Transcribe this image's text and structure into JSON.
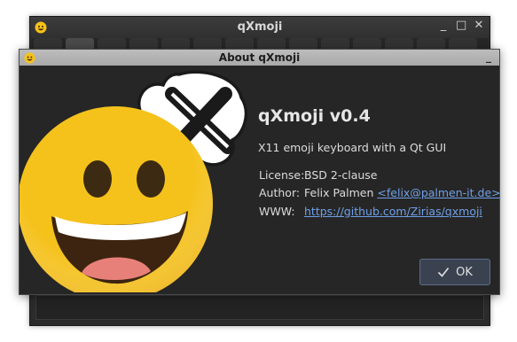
{
  "main_window": {
    "title": "qXmoji",
    "buttons": {
      "minimize": "_",
      "maximize": "□",
      "close": "✕"
    }
  },
  "dialog": {
    "title": "About qXmoji",
    "app_name": "qXmoji v0.4",
    "description": "X11 emoji keyboard with a Qt GUI",
    "license_label": "License:",
    "license_value": "BSD 2-clause",
    "author_label": "Author:",
    "author_name": "Felix Palmen",
    "author_email": "<felix@palmen-it.de>",
    "www_label": "WWW:",
    "www_url": "https://github.com/Zirias/qxmoji",
    "ok_label": "OK"
  },
  "colors": {
    "link": "#6fa0e8",
    "dialog_bg": "#262626",
    "titlebar": "#b3b3b3",
    "emoji_yellow": "#f5c21b"
  }
}
